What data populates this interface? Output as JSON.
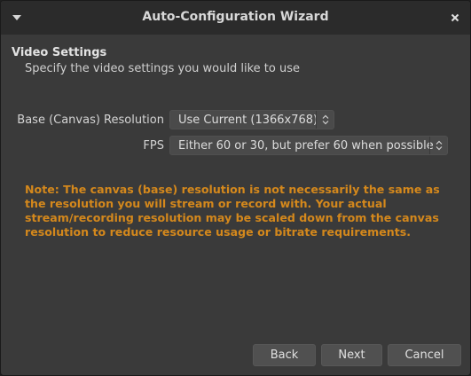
{
  "window": {
    "title": "Auto-Configuration Wizard"
  },
  "section": {
    "title": "Video Settings",
    "subtitle": "Specify the video settings you would like to use"
  },
  "form": {
    "resolution_label": "Base (Canvas) Resolution",
    "resolution_value": "Use Current (1366x768)",
    "fps_label": "FPS",
    "fps_value": "Either 60 or 30, but prefer 60 when possible"
  },
  "note": "Note: The canvas (base) resolution is not necessarily the same as the resolution you will stream or record with. Your actual stream/recording resolution may be scaled down from the canvas resolution to reduce resource usage or bitrate requirements.",
  "buttons": {
    "back": "Back",
    "next": "Next",
    "cancel": "Cancel"
  },
  "icons": {
    "menu": "menu-triangle-icon",
    "close": "close-icon",
    "spinner": "updown-arrows-icon"
  },
  "colors": {
    "note": "#d4881c",
    "window_bg": "#3a3a3a",
    "titlebar_bg": "#2b2b2b"
  }
}
